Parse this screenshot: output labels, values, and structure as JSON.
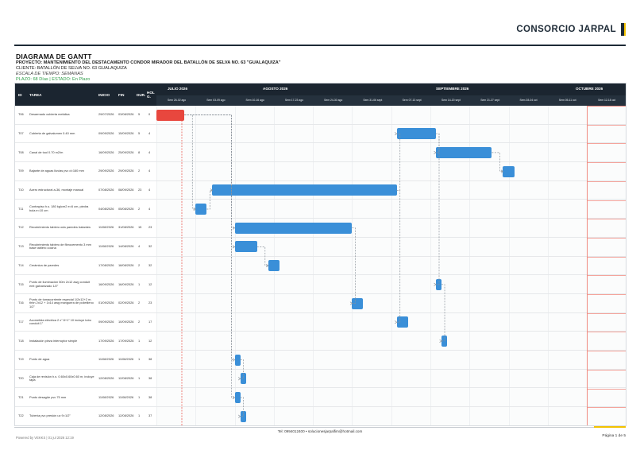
{
  "brand": {
    "name": "CONSORCIO JARPAL"
  },
  "header": {
    "title": "DIAGRAMA DE GANTT",
    "project": "PROYECTO: MANTENIMIENTO DEL DESTACAMENTO CONDOR MIRADOR DEL BATALLÓN DE SELVA NO. 63 \"GUALAQUIZA\"",
    "client": "CLIENTE: BATALLÓN DE SELVA NO. 63 GUALAQUIZA",
    "scale": "ESCALA DE TIEMPO: SEMANAS",
    "status": "PLAZO: 68 Días  |  ESTADO: En Plazo"
  },
  "columns": {
    "id": "ID",
    "task": "TAREA",
    "start": "INICIO",
    "end": "FIN",
    "dur": "DUR.",
    "hol": "HOL G."
  },
  "months": [
    {
      "label": "JULIO 2026"
    },
    {
      "label": "AGOSTO 2026"
    },
    {
      "label": "SEPTIEMBRE 2026"
    },
    {
      "label": "OCTUBRE 2026"
    }
  ],
  "weeks": [
    "Sem 26-02 ago",
    "Sem 03-09 ago",
    "Sem 10-16 ago",
    "Sem 17-23 ago",
    "Sem 24-30 ago",
    "Sem 31-06 sept",
    "Sem 07-13 sept",
    "Sem 14-20 sept",
    "Sem 21-27 sept",
    "Sem 28-04 oct",
    "Sem 05-11 oct",
    "Sem 12-18 oct"
  ],
  "tasks": [
    {
      "id": "T06",
      "name": "Desarmado cubierta metálica",
      "start": "29/07/2026",
      "end": "03/08/2026",
      "dur": "5",
      "hol": "0",
      "critical": true,
      "bar_start": 0,
      "bar_len": 5
    },
    {
      "id": "T07",
      "name": "Cubierta de galvalumen 0.40 mm",
      "start": "09/09/2026",
      "end": "15/09/2026",
      "dur": "5",
      "hol": "4",
      "critical": false,
      "bar_start": 43,
      "bar_len": 7
    },
    {
      "id": "T08",
      "name": "Canal de tool 0.70 m2/m",
      "start": "16/09/2026",
      "end": "25/09/2026",
      "dur": "8",
      "hol": "4",
      "critical": false,
      "bar_start": 50,
      "bar_len": 10
    },
    {
      "id": "T09",
      "name": "Bajante de aguas lluvias pvc d=160 mm",
      "start": "29/09/2026",
      "end": "29/09/2026",
      "dur": "2",
      "hol": "4",
      "critical": false,
      "bar_start": 62,
      "bar_len": 2
    },
    {
      "id": "T10",
      "name": "Acero estructural a-36, montaje manual",
      "start": "07/08/2026",
      "end": "08/09/2026",
      "dur": "23",
      "hol": "4",
      "critical": false,
      "bar_start": 10,
      "bar_len": 33
    },
    {
      "id": "T11",
      "name": "Contrapiso h.s. 180 kg/cm2 e=6 cm, piedra bola e=10 cm",
      "start": "04/08/2026",
      "end": "05/08/2026",
      "dur": "2",
      "hol": "4",
      "critical": false,
      "bar_start": 7,
      "bar_len": 2
    },
    {
      "id": "T12",
      "name": "Recubrimiento tablero oda paredes tratantes",
      "start": "11/08/2026",
      "end": "31/08/2026",
      "dur": "15",
      "hol": "23",
      "critical": false,
      "bar_start": 14,
      "bar_len": 21
    },
    {
      "id": "T13",
      "name": "Recubrimiento tablero de fibrocemento 3 mm base tablero cocina",
      "start": "11/08/2026",
      "end": "14/08/2026",
      "dur": "4",
      "hol": "32",
      "critical": false,
      "bar_start": 14,
      "bar_len": 4
    },
    {
      "id": "T14",
      "name": "Cerámica de paredes",
      "start": "17/08/2026",
      "end": "18/08/2026",
      "dur": "2",
      "hol": "32",
      "critical": false,
      "bar_start": 20,
      "bar_len": 2
    },
    {
      "id": "T15",
      "name": "Punto de iluminación 50m 2x12 awg conduit emt galvanizado 1/2\"",
      "start": "16/09/2026",
      "end": "16/09/2026",
      "dur": "1",
      "hol": "12",
      "critical": false,
      "bar_start": 50,
      "bar_len": 1
    },
    {
      "id": "T16",
      "name": "Punto de tomacorriente especial 1/2x12+2 m. thhn 2x12 + 1x14 awg manguera de polietileno 1/2\"",
      "start": "01/09/2026",
      "end": "02/09/2026",
      "dur": "2",
      "hol": "23",
      "critical": false,
      "bar_start": 35,
      "bar_len": 2
    },
    {
      "id": "T17",
      "name": "Acometida eléctrica 2 x\" 8+1\" 10 incluye tubo conduit 1\"",
      "start": "09/09/2026",
      "end": "10/09/2026",
      "dur": "2",
      "hol": "17",
      "critical": false,
      "bar_start": 43,
      "bar_len": 2
    },
    {
      "id": "T18",
      "name": "Instalación pieza interruptor simple",
      "start": "17/09/2026",
      "end": "17/09/2026",
      "dur": "1",
      "hol": "12",
      "critical": false,
      "bar_start": 51,
      "bar_len": 1
    },
    {
      "id": "T19",
      "name": "Punto de agua",
      "start": "11/08/2026",
      "end": "11/08/2026",
      "dur": "1",
      "hol": "38",
      "critical": false,
      "bar_start": 14,
      "bar_len": 1
    },
    {
      "id": "T20",
      "name": "Caja de revisión h.s. 0.60x0.60x0.60 m, incluye tapa",
      "start": "12/08/2026",
      "end": "12/08/2026",
      "dur": "1",
      "hol": "38",
      "critical": false,
      "bar_start": 15,
      "bar_len": 1
    },
    {
      "id": "T21",
      "name": "Punto desagüe pvc 75 mm",
      "start": "11/08/2026",
      "end": "11/08/2026",
      "dur": "1",
      "hol": "38",
      "critical": false,
      "bar_start": 14,
      "bar_len": 1
    },
    {
      "id": "T22",
      "name": "Tubería pvc presión uv 9=1/2\"",
      "start": "12/08/2026",
      "end": "12/08/2026",
      "dur": "1",
      "hol": "37",
      "critical": false,
      "bar_start": 15,
      "bar_len": 1
    }
  ],
  "colors": {
    "bar": "#3a8fd8",
    "critical": "#e8473e",
    "header": "#1b2530"
  },
  "footer": {
    "contact": "Tel: 0994012400  •  solucionesjarpalfim@hotmail.com",
    "powered": "Powered by VEKKS | 01 jul 2026 12:19",
    "page": "Página 1 de 5"
  }
}
